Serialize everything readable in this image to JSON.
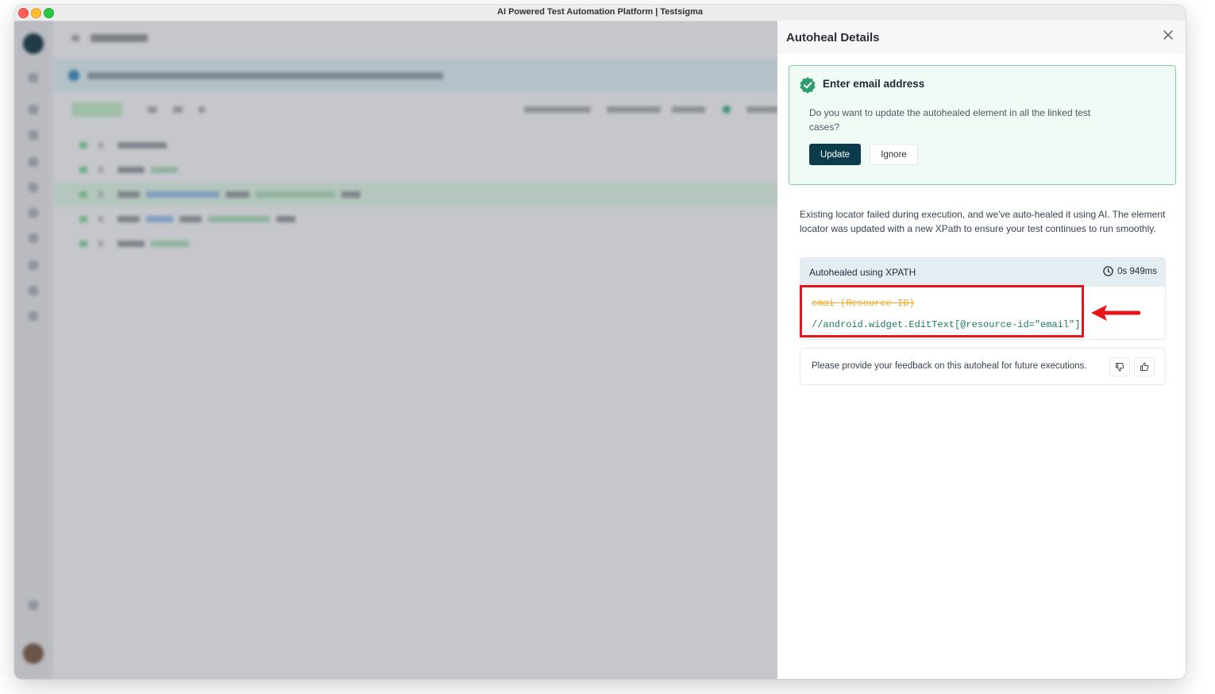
{
  "window": {
    "title": "AI Powered Test Automation Platform | Testsigma"
  },
  "panel": {
    "title": "Autoheal Details",
    "close_icon": "close-icon",
    "card": {
      "icon": "verified-badge-icon",
      "title": "Enter email address",
      "question": "Do you want to update the autohealed element in all the linked test cases?",
      "update_label": "Update",
      "ignore_label": "Ignore"
    },
    "description": "Existing locator failed during execution, and we've auto-healed it using AI. The element locator was updated with a new XPath to ensure your test continues to run smoothly.",
    "xpath": {
      "label": "Autohealed using XPATH",
      "duration": "0s 949ms",
      "duration_icon": "clock-icon",
      "old_locator": "emai (Resource ID)",
      "new_locator": "//android.widget.EditText[@resource-id=\"email\"]"
    },
    "feedback": {
      "text": "Please provide your feedback on this autoheal for future executions.",
      "thumbs_down_icon": "thumbs-down-icon",
      "thumbs_up_icon": "thumbs-up-icon"
    }
  },
  "colors": {
    "accent_dark": "#0c3c4c",
    "success_border": "#7ed0a2",
    "success_bg": "#f1fbf5",
    "highlight_red": "#e8141c",
    "old_locator": "#f5a623",
    "new_locator": "#1f7a63"
  }
}
